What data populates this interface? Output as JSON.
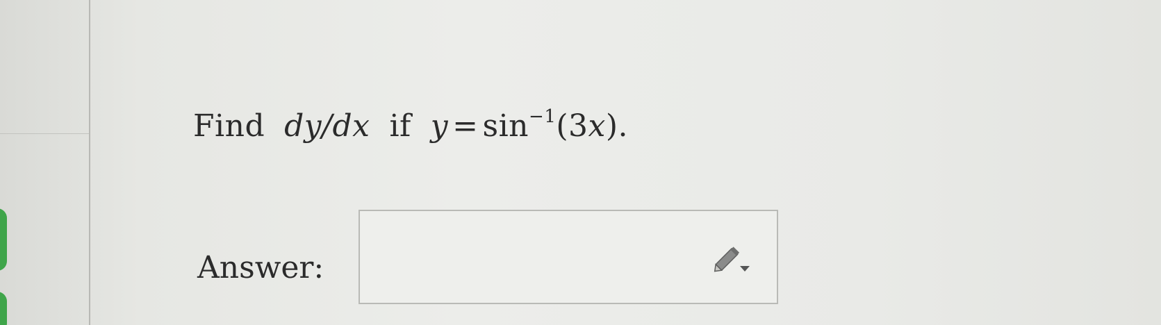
{
  "question": {
    "find": "Find",
    "derivative": "dy/dx",
    "if": "if",
    "lhs": "y",
    "equals": "=",
    "func": "sin",
    "exponent": "−1",
    "arg_open": "(3",
    "arg_var": "x",
    "arg_close": ")."
  },
  "answer": {
    "label": "Answer:",
    "value": ""
  },
  "icons": {
    "pencil": "pencil-dropdown-icon"
  },
  "colors": {
    "accent_green": "#3fa54a",
    "text": "#2b2b2b"
  }
}
